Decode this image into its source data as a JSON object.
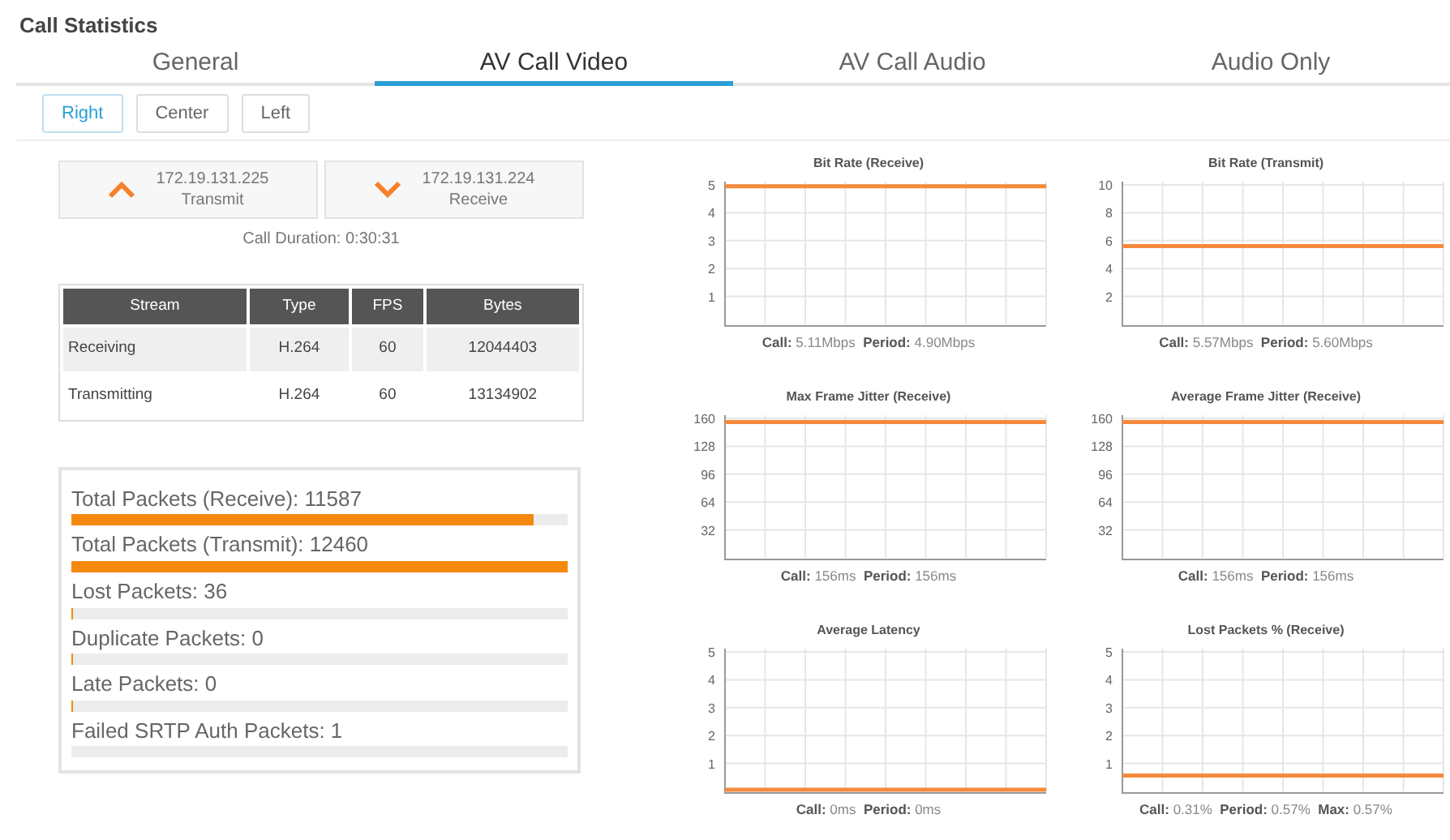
{
  "title": "Call Statistics",
  "tabs": [
    {
      "label": "General",
      "selected": false
    },
    {
      "label": "AV Call Video",
      "selected": true
    },
    {
      "label": "AV Call Audio",
      "selected": false
    },
    {
      "label": "Audio Only",
      "selected": false
    }
  ],
  "views": [
    {
      "label": "Right",
      "selected": true
    },
    {
      "label": "Center",
      "selected": false
    },
    {
      "label": "Left",
      "selected": false
    }
  ],
  "endpoints": [
    {
      "kind": "up",
      "address": "172.19.131.225",
      "label": "Transmit"
    },
    {
      "kind": "down",
      "address": "172.19.131.224",
      "label": "Receive"
    }
  ],
  "call_duration": "Call Duration: 0:30:31",
  "streams": {
    "columns": [
      "Stream",
      "Type",
      "FPS",
      "Bytes"
    ],
    "rows": [
      [
        "Receiving",
        "H.264",
        "60",
        "12044403"
      ],
      [
        "Transmitting",
        "H.264",
        "60",
        "13134902"
      ]
    ]
  },
  "packets": [
    {
      "label": "Total Packets (Receive): 11587",
      "level": 0.93
    },
    {
      "label": "Total Packets (Transmit): 12460",
      "level": 1.0
    },
    {
      "label": "Lost Packets: 36",
      "level": 0.003
    },
    {
      "label": "Duplicate Packets: 0",
      "level": 0.003
    },
    {
      "label": "Late Packets: 0",
      "level": 0.003
    },
    {
      "label": "Failed SRTP Auth Packets: 1",
      "level": 0
    }
  ],
  "charts": [
    {
      "footer": "**Call:** 5.11Mbps  **Period:** 4.90Mbps",
      "chart_data": {
        "type": "line",
        "grid": true,
        "title": "Bit Rate (Receive)",
        "ylim": [
          0,
          5
        ],
        "yticks": [
          1,
          2,
          3,
          4,
          5
        ],
        "series": [
          {
            "color": "#f58a3c",
            "values": [
              4.95,
              4.95,
              4.95,
              4.95,
              4.95,
              4.95,
              4.95,
              4.95,
              4.95
            ]
          }
        ]
      }
    },
    {
      "footer": "**Call:** 5.57Mbps  **Period:** 5.60Mbps",
      "chart_data": {
        "type": "line",
        "grid": true,
        "title": "Bit Rate (Transmit)",
        "ylim": [
          0,
          10
        ],
        "yticks": [
          2,
          4,
          6,
          8,
          10
        ],
        "series": [
          {
            "color": "#f58a3c",
            "values": [
              5.6,
              5.6,
              5.6,
              5.6,
              5.6,
              5.6,
              5.6,
              5.6,
              5.6
            ]
          }
        ]
      }
    },
    {
      "footer": "**Call:** 156ms  **Period:** 156ms",
      "chart_data": {
        "type": "line",
        "title": "Max Frame Jitter (Receive)",
        "grid": true,
        "ylim": [
          0,
          160
        ],
        "yticks": [
          32,
          64,
          96,
          128,
          160
        ],
        "series": [
          {
            "color": "#f58a3c",
            "values": [
              156,
              156,
              156,
              156,
              156,
              156,
              156,
              156,
              156
            ]
          }
        ]
      }
    },
    {
      "footer": "**Call:** 156ms  **Period:** 156ms",
      "chart_data": {
        "type": "line",
        "title": "Average Frame Jitter (Receive)",
        "grid": true,
        "ylim": [
          0,
          160
        ],
        "yticks": [
          32,
          64,
          96,
          128,
          160
        ],
        "series": [
          {
            "color": "#f58a3c",
            "values": [
              156,
              156,
              156,
              156,
              156,
              156,
              156,
              156,
              156
            ]
          }
        ]
      }
    },
    {
      "footer": "**Call:** 0ms  **Period:** 0ms",
      "chart_data": {
        "type": "line",
        "title": "Average Latency",
        "grid": true,
        "ylim": [
          0,
          5
        ],
        "yticks": [
          1,
          2,
          3,
          4,
          5
        ],
        "series": [
          {
            "color": "#f58a3c",
            "values": [
              0,
              0,
              0,
              0,
              0,
              0,
              0,
              0,
              0
            ]
          }
        ]
      }
    },
    {
      "footer": "**Call:** 0.31%  **Period:** 0.57%  **Max:** 0.57%",
      "chart_data": {
        "type": "line",
        "title": "Lost Packets % (Receive)",
        "grid": true,
        "ylim": [
          0,
          5
        ],
        "yticks": [
          1,
          2,
          3,
          4,
          5
        ],
        "series": [
          {
            "color": "#f58a3c",
            "values": [
              0.57,
              0.57,
              0.57,
              0.57,
              0.57,
              0.57,
              0.57,
              0.57,
              0.57
            ]
          }
        ]
      }
    }
  ]
}
